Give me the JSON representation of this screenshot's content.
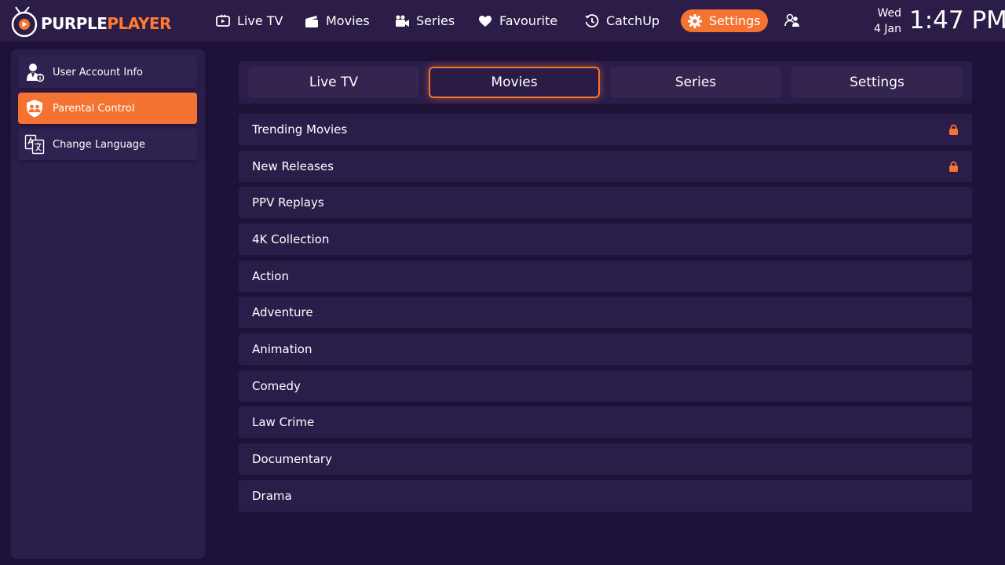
{
  "app": {
    "logo_part1": "PURPLE",
    "logo_part2": "PLAYER",
    "accent_color": "#f47331"
  },
  "nav": {
    "items": [
      {
        "label": "Live TV",
        "icon": "tv-play-icon"
      },
      {
        "label": "Movies",
        "icon": "clapperboard-icon"
      },
      {
        "label": "Series",
        "icon": "camera-icon"
      },
      {
        "label": "Favourite",
        "icon": "heart-icon"
      },
      {
        "label": "CatchUp",
        "icon": "history-clock-icon"
      },
      {
        "label": "Settings",
        "icon": "gear-icon",
        "active": true
      }
    ],
    "profiles_icon": "switch-user-icon"
  },
  "datetime": {
    "day": "Wed",
    "date": "4 Jan",
    "time": "1:47 PM"
  },
  "sidebar": {
    "items": [
      {
        "label": "User Account Info",
        "icon": "user-info-icon"
      },
      {
        "label": "Parental Control",
        "icon": "parental-shield-icon",
        "active": true
      },
      {
        "label": "Change Language",
        "icon": "translate-icon"
      }
    ]
  },
  "tabs": {
    "items": [
      {
        "label": "Live TV"
      },
      {
        "label": "Movies",
        "active": true
      },
      {
        "label": "Series"
      },
      {
        "label": "Settings"
      }
    ]
  },
  "categories": {
    "items": [
      {
        "label": "Trending Movies",
        "locked": true
      },
      {
        "label": "New Releases",
        "locked": true
      },
      {
        "label": "PPV Replays",
        "locked": false
      },
      {
        "label": "4K Collection",
        "locked": false
      },
      {
        "label": "Action",
        "locked": false
      },
      {
        "label": "Adventure",
        "locked": false
      },
      {
        "label": "Animation",
        "locked": false
      },
      {
        "label": "Comedy",
        "locked": false
      },
      {
        "label": "Law Crime",
        "locked": false
      },
      {
        "label": "Documentary",
        "locked": false
      },
      {
        "label": "Drama",
        "locked": false
      }
    ]
  }
}
